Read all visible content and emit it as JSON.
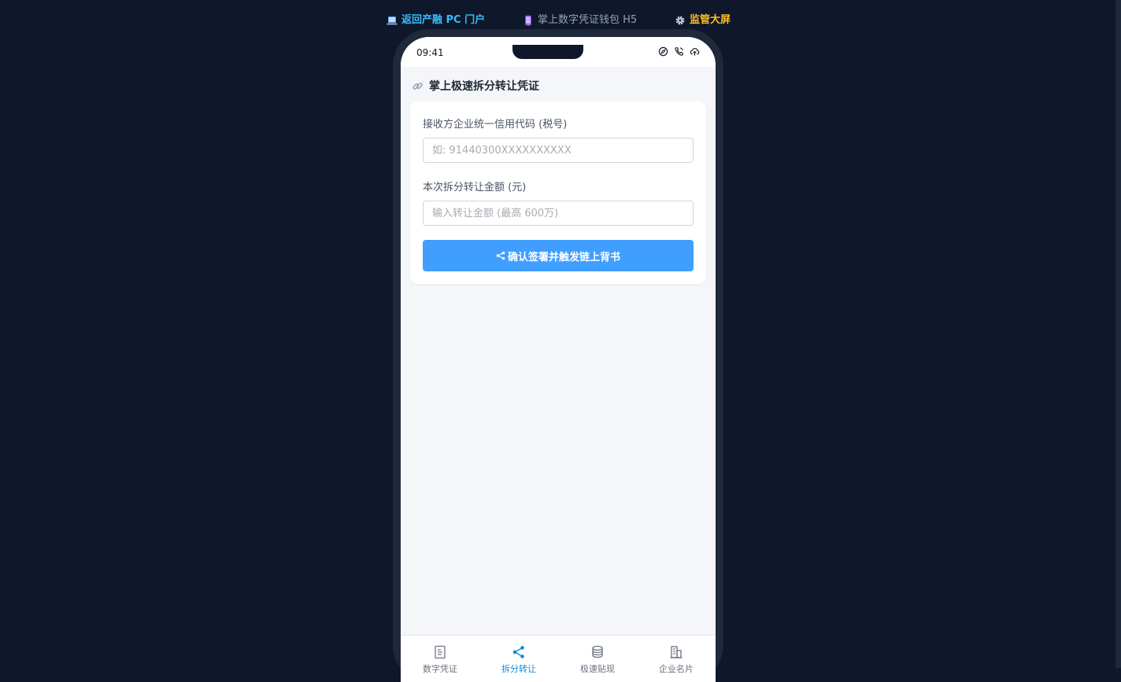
{
  "topnav": {
    "pc_portal": {
      "label": "返回产融 PC 门户",
      "icon": "laptop-icon"
    },
    "h5_wallet": {
      "label": "掌上数字凭证钱包 H5",
      "icon": "phone-icon"
    },
    "supervision": {
      "label": "监管大屏",
      "icon": "gear-icon"
    }
  },
  "status_bar": {
    "time": "09:41",
    "icons": [
      "compass-icon",
      "phone-call-icon",
      "cloud-upload-icon"
    ]
  },
  "page": {
    "icon": "link-icon",
    "title": "掌上极速拆分转让凭证"
  },
  "form": {
    "credit_code": {
      "label": "接收方企业统一信用代码 (税号)",
      "value": "",
      "placeholder": "如: 91440300XXXXXXXXXX"
    },
    "amount": {
      "label": "本次拆分转让金额 (元)",
      "value": "",
      "placeholder": "输入转让金额 (最高 600万)"
    },
    "submit": {
      "label": "确认签署并触发链上背书",
      "icon": "share-icon"
    }
  },
  "tabbar": {
    "items": [
      {
        "label": "数字凭证",
        "icon": "document-icon",
        "active": false
      },
      {
        "label": "拆分转让",
        "icon": "share-icon",
        "active": true
      },
      {
        "label": "极速贴现",
        "icon": "coins-icon",
        "active": false
      },
      {
        "label": "企业名片",
        "icon": "building-icon",
        "active": false
      }
    ]
  },
  "colors": {
    "background": "#0f172a",
    "primary": "#409eff",
    "active_tab": "#0d8bd6",
    "link_blue": "#38bdf8",
    "accent_gold": "#fbbf24"
  }
}
